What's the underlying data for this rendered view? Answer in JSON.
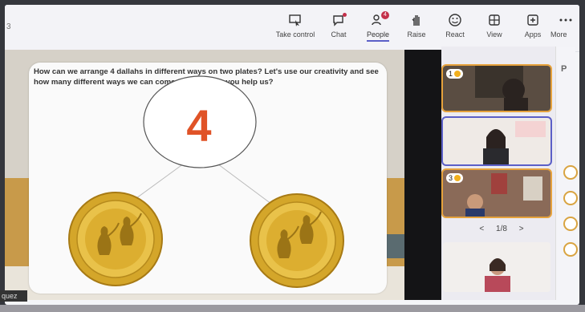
{
  "toolbar": {
    "left_fragment": "3",
    "buttons": [
      {
        "label": "Take control",
        "icon": "take-control-icon"
      },
      {
        "label": "Chat",
        "icon": "chat-icon"
      },
      {
        "label": "People",
        "icon": "people-icon",
        "badge": "4"
      },
      {
        "label": "Raise",
        "icon": "raise-hand-icon"
      },
      {
        "label": "React",
        "icon": "react-icon"
      },
      {
        "label": "View",
        "icon": "view-icon"
      },
      {
        "label": "Apps",
        "icon": "apps-icon"
      },
      {
        "label": "More",
        "icon": "more-icon"
      }
    ]
  },
  "slide": {
    "question": "How can we arrange 4 dallahs in different ways on two plates? Let's use our creativity and see how many different ways we can come up with! Can you help us?",
    "whole_number": "4",
    "plates": [
      {
        "dallah_count": 2
      },
      {
        "dallah_count": 2
      }
    ]
  },
  "participants": {
    "tiles": [
      {
        "badge": "1"
      },
      {
        "badge": ""
      },
      {
        "badge": "3"
      },
      {
        "badge": ""
      }
    ],
    "pager": {
      "prev": "<",
      "text": "1/8",
      "next": ">"
    }
  },
  "side_panel": {
    "header_fragment": "P"
  },
  "corner_label": "quez",
  "colors": {
    "accent": "#5b5fc7",
    "number": "#e05327",
    "gold": "#d4a62a",
    "badge_red": "#c4314b"
  }
}
